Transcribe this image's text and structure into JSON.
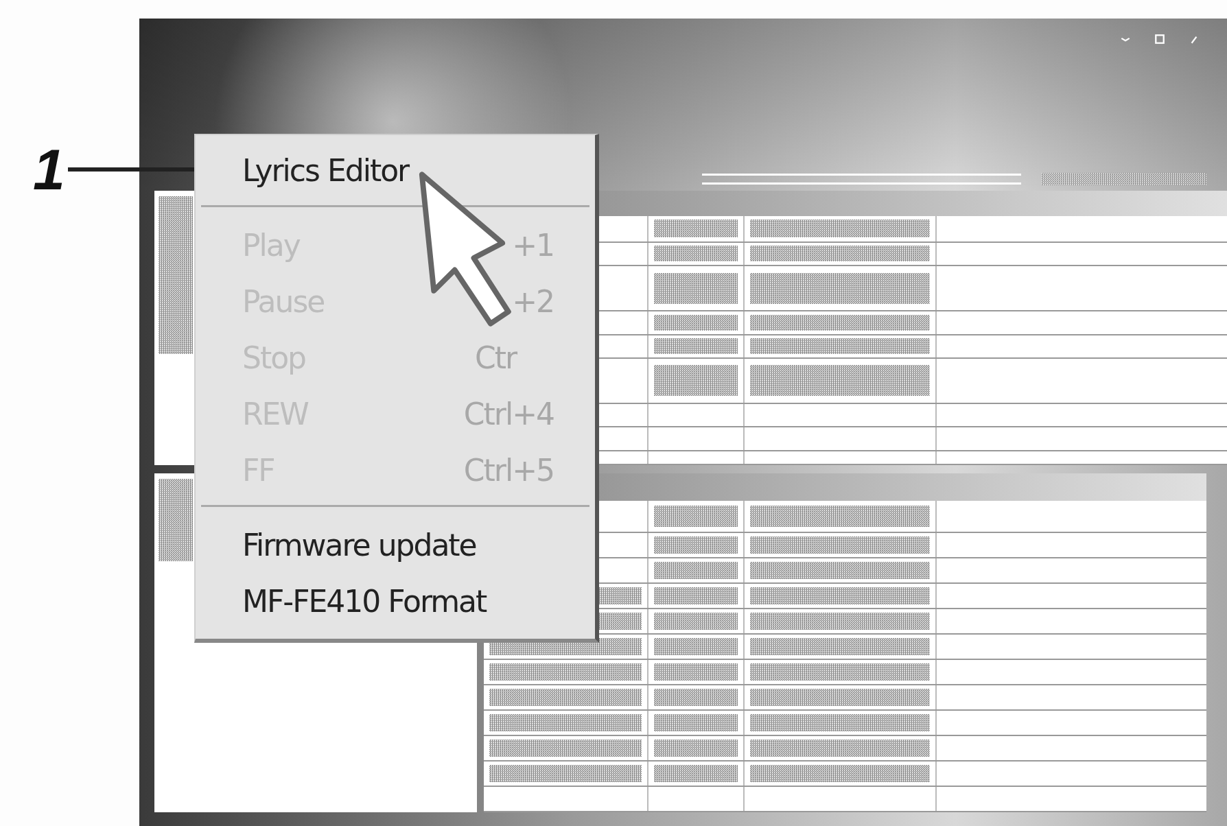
{
  "callout": {
    "label": "1"
  },
  "context_menu": {
    "items": [
      {
        "kind": "item",
        "label": "Lyrics Editor",
        "disabled": false
      },
      {
        "kind": "separator"
      },
      {
        "kind": "item",
        "label": "Play",
        "shortcut": "+1",
        "disabled": true
      },
      {
        "kind": "item",
        "label": "Pause",
        "shortcut": "+2",
        "disabled": true
      },
      {
        "kind": "item",
        "label": "Stop",
        "shortcut": "Ctr",
        "disabled": true
      },
      {
        "kind": "item",
        "label": "REW",
        "shortcut": "Ctrl+4",
        "disabled": true
      },
      {
        "kind": "item",
        "label": "FF",
        "shortcut": "Ctrl+5",
        "disabled": true
      },
      {
        "kind": "separator"
      },
      {
        "kind": "item",
        "label": "Firmware update",
        "disabled": false
      },
      {
        "kind": "item",
        "label": "MF-FE410 Format",
        "disabled": false
      }
    ]
  }
}
